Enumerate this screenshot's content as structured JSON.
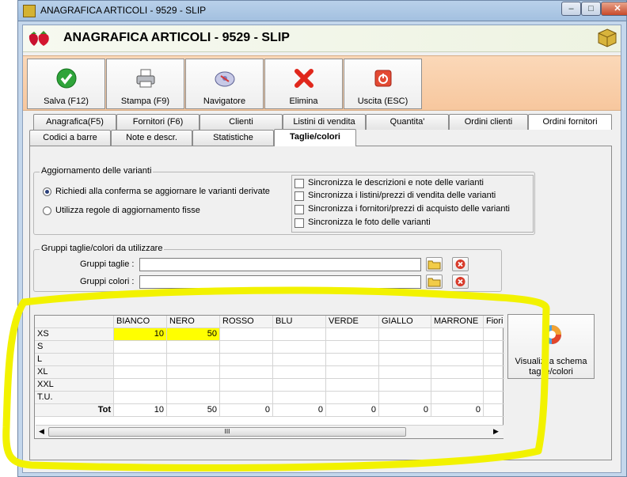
{
  "window": {
    "title": "ANAGRAFICA ARTICOLI - 9529 - SLIP"
  },
  "header": {
    "title": "ANAGRAFICA ARTICOLI - 9529 - SLIP"
  },
  "toolbar": [
    {
      "label": "Salva (F12)",
      "icon": "check-icon"
    },
    {
      "label": "Stampa (F9)",
      "icon": "printer-icon"
    },
    {
      "label": "Navigatore",
      "icon": "navigator-icon"
    },
    {
      "label": "Elimina",
      "icon": "delete-x-icon"
    },
    {
      "label": "Uscita (ESC)",
      "icon": "power-icon"
    }
  ],
  "tabs_row1": [
    "Anagrafica(F5)",
    "Fornitori (F6)",
    "Clienti",
    "Listini di vendita",
    "Quantita'",
    "Ordini clienti",
    "Ordini fornitori"
  ],
  "tabs_row2": [
    "Codici a barre",
    "Note e descr.",
    "Statistiche",
    "Taglie/colori"
  ],
  "active_tab": "Taglie/colori",
  "update": {
    "title": "Aggiornamento delle varianti",
    "radio1": "Richiedi alla conferma se aggiornare le varianti derivate",
    "radio2": "Utilizza regole di aggiornamento fisse",
    "checks": [
      "Sincronizza le descrizioni e note delle varianti",
      "Sincronizza i listini/prezzi di vendita delle varianti",
      "Sincronizza i fornitori/prezzi di acquisto delle varianti",
      "Sincronizza le foto delle varianti"
    ]
  },
  "groups": {
    "title": "Gruppi taglie/colori da utilizzare",
    "sizes_label": "Gruppi taglie :",
    "colors_label": "Gruppi colori :",
    "sizes_value": "",
    "colors_value": ""
  },
  "grid": {
    "columns": [
      "BIANCO",
      "NERO",
      "ROSSO",
      "BLU",
      "VERDE",
      "GIALLO",
      "MARRONE",
      "Fiori"
    ],
    "rows": [
      {
        "label": "XS",
        "values": [
          "10",
          "50",
          "",
          "",
          "",
          "",
          "",
          ""
        ]
      },
      {
        "label": "S",
        "values": [
          "",
          "",
          "",
          "",
          "",
          "",
          "",
          ""
        ]
      },
      {
        "label": "L",
        "values": [
          "",
          "",
          "",
          "",
          "",
          "",
          "",
          ""
        ]
      },
      {
        "label": "XL",
        "values": [
          "",
          "",
          "",
          "",
          "",
          "",
          "",
          ""
        ]
      },
      {
        "label": "XXL",
        "values": [
          "",
          "",
          "",
          "",
          "",
          "",
          "",
          ""
        ]
      },
      {
        "label": "T.U.",
        "values": [
          "",
          "",
          "",
          "",
          "",
          "",
          "",
          ""
        ]
      }
    ],
    "total_label": "Tot",
    "totals": [
      "10",
      "50",
      "0",
      "0",
      "0",
      "0",
      "0",
      ""
    ],
    "scroll_thumb": "III"
  },
  "view_button": {
    "label": "Visualizza schema taglie/colori"
  },
  "colors": {
    "highlight": "#ffff00",
    "toolbar": "#f9cfa9",
    "annotation": "#f2f200"
  }
}
